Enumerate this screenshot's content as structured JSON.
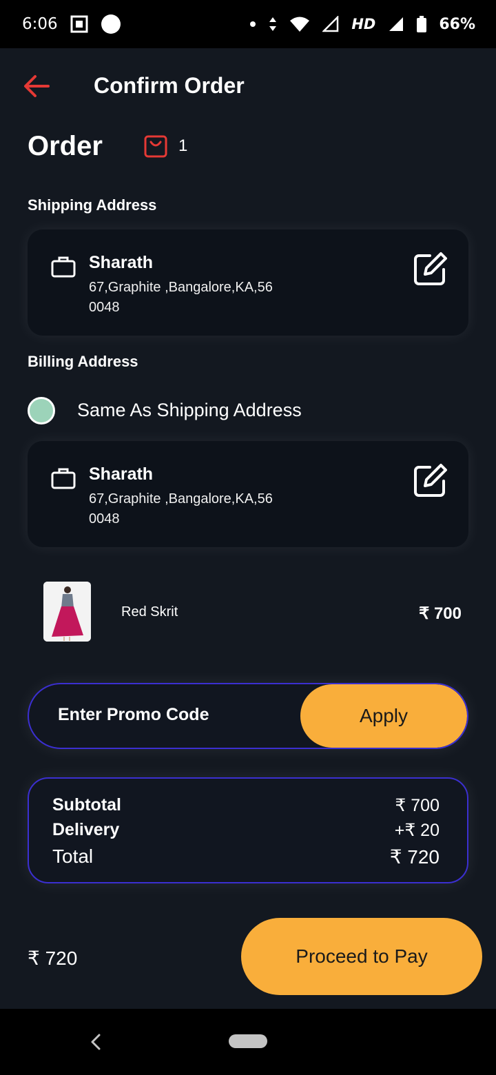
{
  "status_bar": {
    "time": "6:06",
    "network": "HD",
    "battery": "66%"
  },
  "header": {
    "title": "Confirm Order"
  },
  "order": {
    "title": "Order",
    "count": "1"
  },
  "shipping": {
    "label": "Shipping Address",
    "name": "Sharath",
    "address_line1": "67,Graphite ,Bangalore,KA,56",
    "address_line2": "0048"
  },
  "billing": {
    "label": "Billing Address",
    "same_as_shipping_label": "Same As Shipping Address",
    "name": "Sharath",
    "address_line1": "67,Graphite ,Bangalore,KA,56",
    "address_line2": "0048"
  },
  "product": {
    "name": "Red Skrit",
    "price": "₹ 700"
  },
  "promo": {
    "placeholder": "Enter Promo Code",
    "apply_label": "Apply"
  },
  "summary": {
    "subtotal_label": "Subtotal",
    "subtotal_value": "₹ 700",
    "delivery_label": "Delivery",
    "delivery_value": "+₹ 20",
    "total_label": "Total",
    "total_value": "₹ 720"
  },
  "footer": {
    "total": "₹ 720",
    "pay_label": "Proceed to Pay"
  },
  "colors": {
    "accent": "#f9ae3b",
    "back_arrow": "#e53935",
    "border": "#3b2fd1",
    "radio_fill": "#9cd3b9"
  }
}
